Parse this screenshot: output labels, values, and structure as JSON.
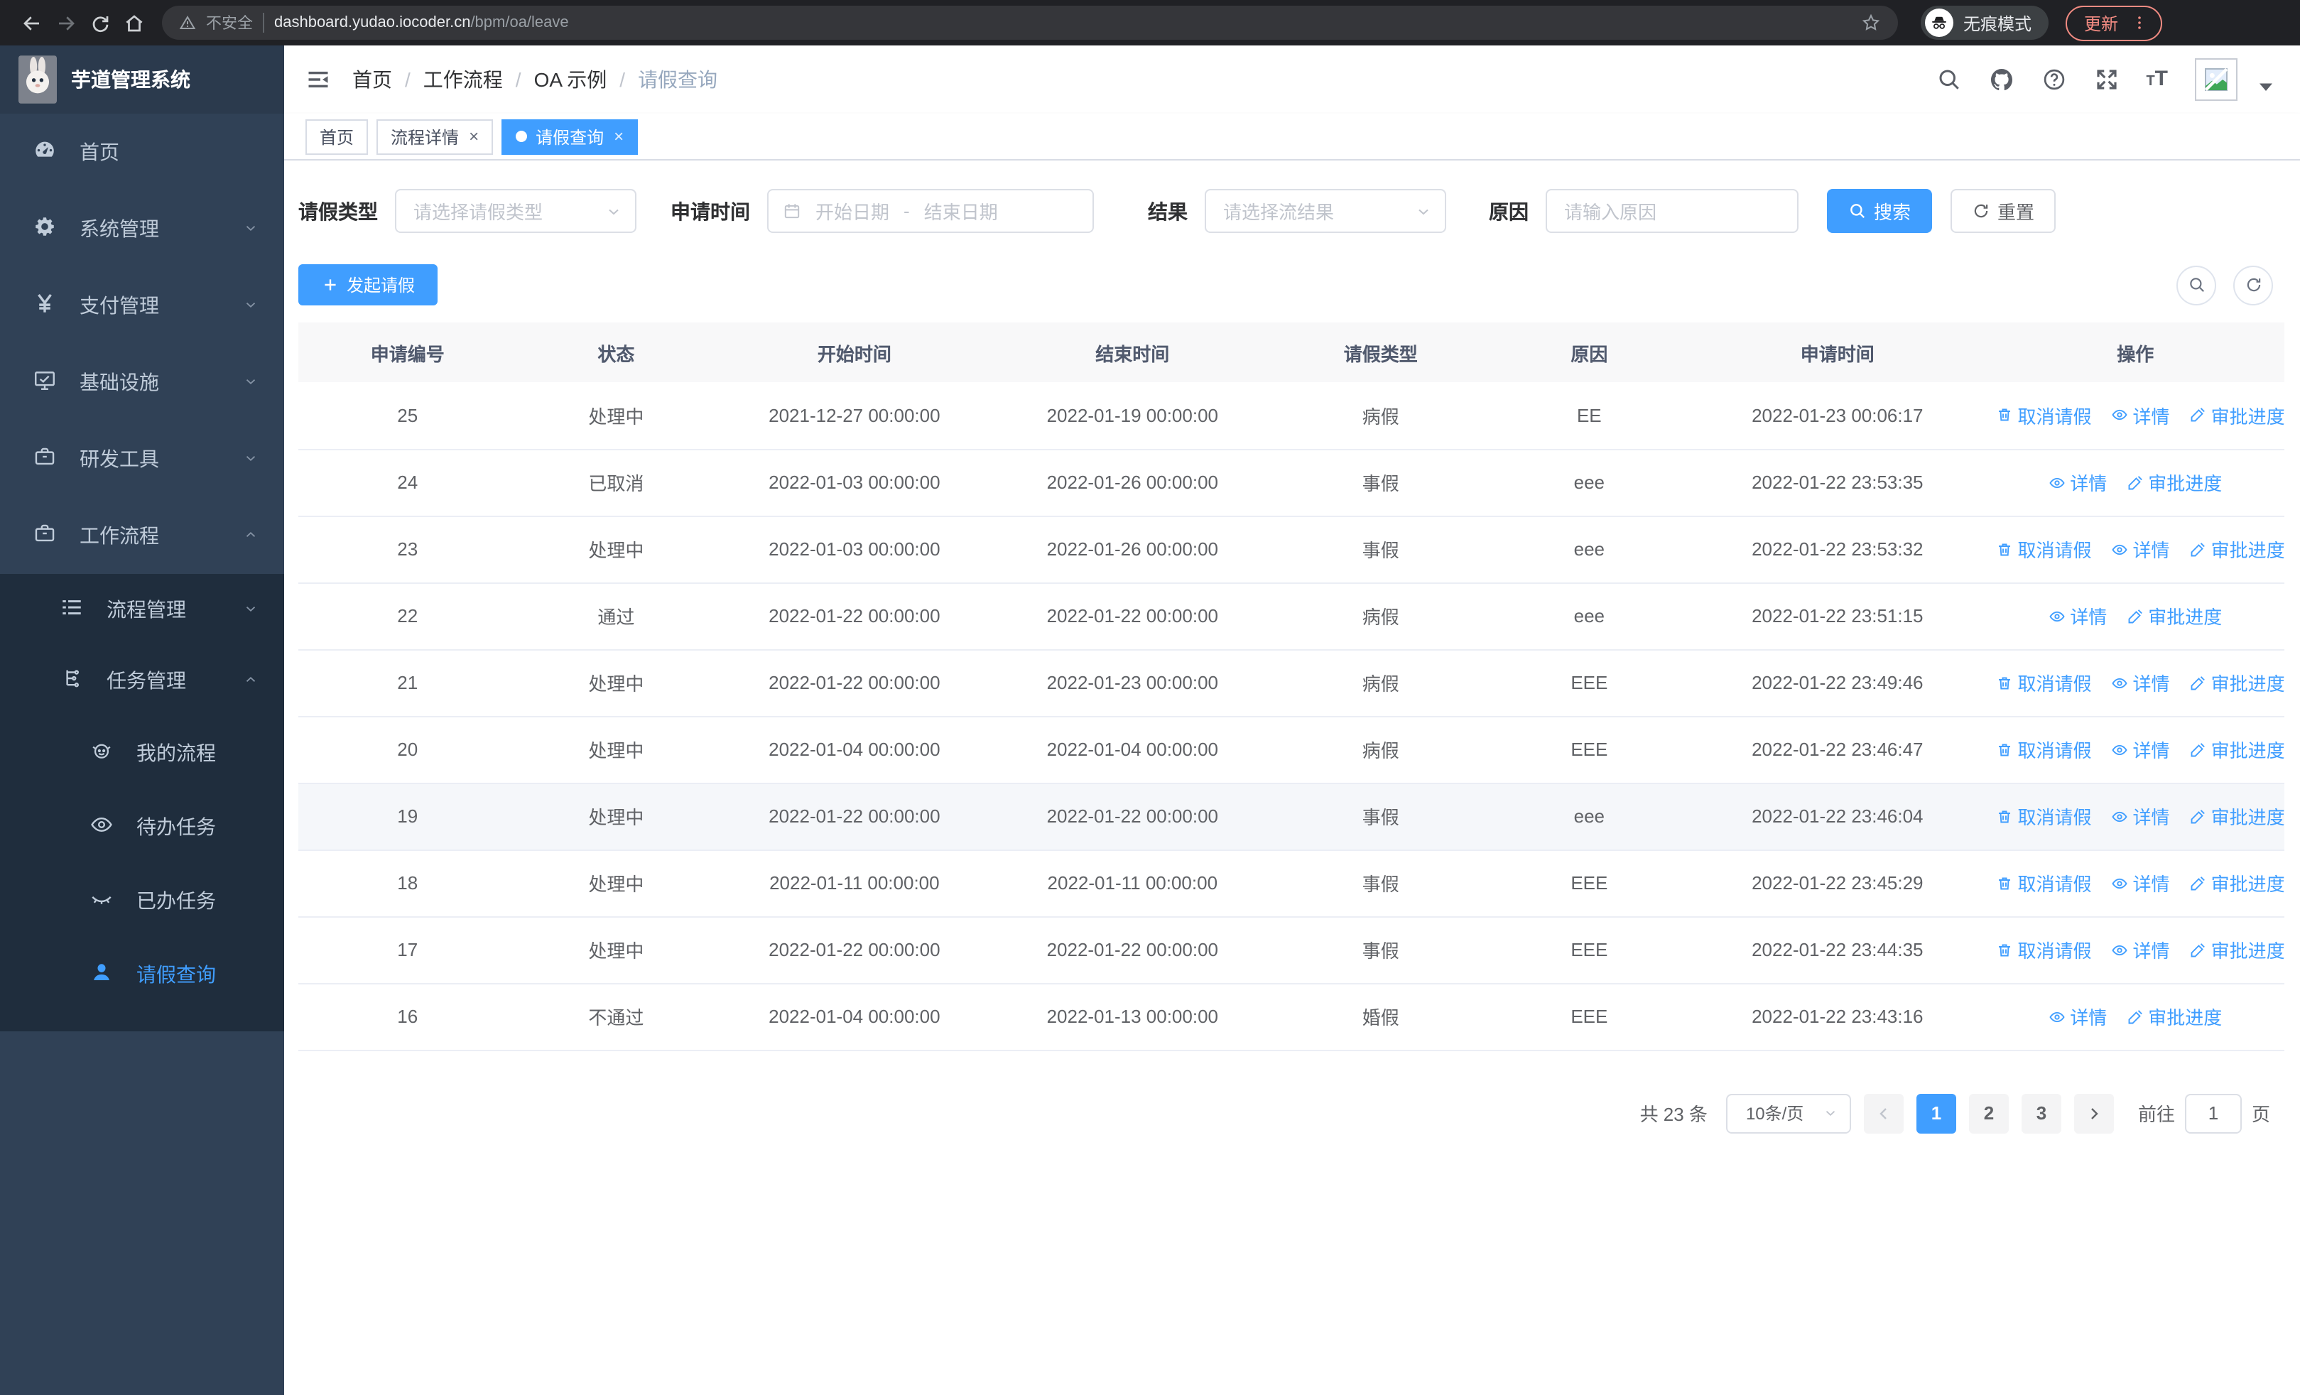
{
  "browser": {
    "security_warning": "不安全",
    "url_host": "dashboard.yudao.iocoder.cn",
    "url_path": "/bpm/oa/leave",
    "incognito_label": "无痕模式",
    "update_button": "更新"
  },
  "colors": {
    "primary": "#409EFF",
    "sidebar_bg": "#304156",
    "submenu_bg": "#1f2d3d",
    "update_accent": "#f28b82"
  },
  "app": {
    "title": "芋道管理系统",
    "breadcrumb": [
      "首页",
      "工作流程",
      "OA 示例",
      "请假查询"
    ],
    "tabs": [
      {
        "label": "首页",
        "closable": false,
        "active": false
      },
      {
        "label": "流程详情",
        "closable": true,
        "active": false
      },
      {
        "label": "请假查询",
        "closable": true,
        "active": true
      }
    ]
  },
  "sidebar": {
    "items": [
      {
        "label": "首页",
        "icon": "dashboard",
        "arrow": ""
      },
      {
        "label": "系统管理",
        "icon": "gear",
        "arrow": "down"
      },
      {
        "label": "支付管理",
        "icon": "yen",
        "arrow": "down"
      },
      {
        "label": "基础设施",
        "icon": "monitor",
        "arrow": "down"
      },
      {
        "label": "研发工具",
        "icon": "toolbox",
        "arrow": "down"
      },
      {
        "label": "工作流程",
        "icon": "briefcase",
        "arrow": "up"
      }
    ],
    "submenu": [
      {
        "label": "流程管理",
        "icon": "list",
        "arrow": "down",
        "level": 1,
        "active": false
      },
      {
        "label": "任务管理",
        "icon": "flow",
        "arrow": "up",
        "level": 1,
        "active": false
      },
      {
        "label": "我的流程",
        "icon": "face",
        "arrow": "",
        "level": 2,
        "active": false
      },
      {
        "label": "待办任务",
        "icon": "eye",
        "arrow": "",
        "level": 2,
        "active": false
      },
      {
        "label": "已办任务",
        "icon": "eye-closed",
        "arrow": "",
        "level": 2,
        "active": false
      },
      {
        "label": "请假查询",
        "icon": "user",
        "arrow": "",
        "level": 2,
        "active": true
      }
    ]
  },
  "filters": {
    "leave_type_label": "请假类型",
    "leave_type_placeholder": "请选择请假类型",
    "apply_time_label": "申请时间",
    "start_date_placeholder": "开始日期",
    "range_separator": "-",
    "end_date_placeholder": "结束日期",
    "result_label": "结果",
    "result_placeholder": "请选择流结果",
    "reason_label": "原因",
    "reason_placeholder": "请输入原因",
    "search_button": "搜索",
    "reset_button": "重置"
  },
  "toolbar": {
    "create_button": "发起请假"
  },
  "table": {
    "headers": [
      "申请编号",
      "状态",
      "开始时间",
      "结束时间",
      "请假类型",
      "原因",
      "申请时间",
      "操作"
    ],
    "action_labels": {
      "cancel": "取消请假",
      "detail": "详情",
      "progress": "审批进度"
    },
    "rows": [
      {
        "id": "25",
        "status": "处理中",
        "start": "2021-12-27 00:00:00",
        "end": "2022-01-19 00:00:00",
        "type": "病假",
        "reason": "EE",
        "applied": "2022-01-23 00:06:17",
        "actions": [
          "cancel",
          "detail",
          "progress"
        ],
        "highlight": false
      },
      {
        "id": "24",
        "status": "已取消",
        "start": "2022-01-03 00:00:00",
        "end": "2022-01-26 00:00:00",
        "type": "事假",
        "reason": "eee",
        "applied": "2022-01-22 23:53:35",
        "actions": [
          "detail",
          "progress"
        ],
        "highlight": false
      },
      {
        "id": "23",
        "status": "处理中",
        "start": "2022-01-03 00:00:00",
        "end": "2022-01-26 00:00:00",
        "type": "事假",
        "reason": "eee",
        "applied": "2022-01-22 23:53:32",
        "actions": [
          "cancel",
          "detail",
          "progress"
        ],
        "highlight": false
      },
      {
        "id": "22",
        "status": "通过",
        "start": "2022-01-22 00:00:00",
        "end": "2022-01-22 00:00:00",
        "type": "病假",
        "reason": "eee",
        "applied": "2022-01-22 23:51:15",
        "actions": [
          "detail",
          "progress"
        ],
        "highlight": false
      },
      {
        "id": "21",
        "status": "处理中",
        "start": "2022-01-22 00:00:00",
        "end": "2022-01-23 00:00:00",
        "type": "病假",
        "reason": "EEE",
        "applied": "2022-01-22 23:49:46",
        "actions": [
          "cancel",
          "detail",
          "progress"
        ],
        "highlight": false
      },
      {
        "id": "20",
        "status": "处理中",
        "start": "2022-01-04 00:00:00",
        "end": "2022-01-04 00:00:00",
        "type": "病假",
        "reason": "EEE",
        "applied": "2022-01-22 23:46:47",
        "actions": [
          "cancel",
          "detail",
          "progress"
        ],
        "highlight": false
      },
      {
        "id": "19",
        "status": "处理中",
        "start": "2022-01-22 00:00:00",
        "end": "2022-01-22 00:00:00",
        "type": "事假",
        "reason": "eee",
        "applied": "2022-01-22 23:46:04",
        "actions": [
          "cancel",
          "detail",
          "progress"
        ],
        "highlight": true
      },
      {
        "id": "18",
        "status": "处理中",
        "start": "2022-01-11 00:00:00",
        "end": "2022-01-11 00:00:00",
        "type": "事假",
        "reason": "EEE",
        "applied": "2022-01-22 23:45:29",
        "actions": [
          "cancel",
          "detail",
          "progress"
        ],
        "highlight": false
      },
      {
        "id": "17",
        "status": "处理中",
        "start": "2022-01-22 00:00:00",
        "end": "2022-01-22 00:00:00",
        "type": "事假",
        "reason": "EEE",
        "applied": "2022-01-22 23:44:35",
        "actions": [
          "cancel",
          "detail",
          "progress"
        ],
        "highlight": false
      },
      {
        "id": "16",
        "status": "不通过",
        "start": "2022-01-04 00:00:00",
        "end": "2022-01-13 00:00:00",
        "type": "婚假",
        "reason": "EEE",
        "applied": "2022-01-22 23:43:16",
        "actions": [
          "detail",
          "progress"
        ],
        "highlight": false
      }
    ]
  },
  "pagination": {
    "total": "共 23 条",
    "page_size": "10条/页",
    "pages": [
      "1",
      "2",
      "3"
    ],
    "active_page": "1",
    "goto_label": "前往",
    "goto_value": "1",
    "page_label": "页"
  }
}
